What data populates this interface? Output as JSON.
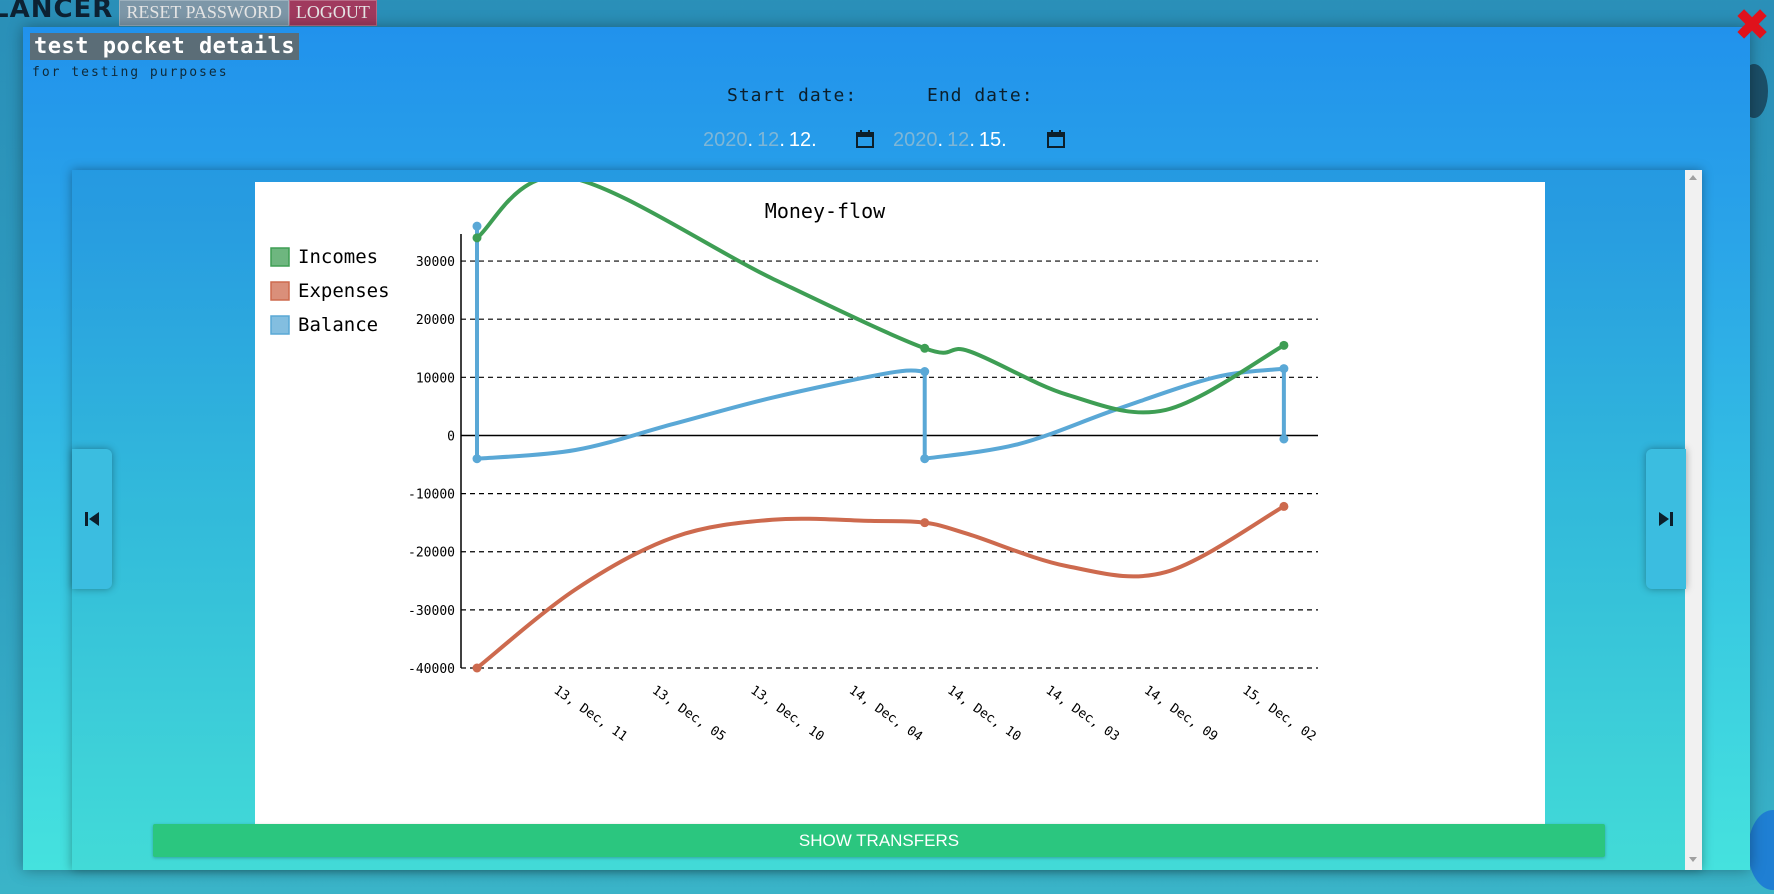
{
  "topbar": {
    "brand": "LANCER",
    "reset_label": "RESET PASSWORD",
    "logout_label": "LOGOUT"
  },
  "modal": {
    "title": "test pocket details",
    "subtitle": "for testing purposes",
    "close_icon": "close-x-icon",
    "start_label": "Start date:",
    "end_label": "End date:",
    "start_date": {
      "year": "2020",
      "month": "12",
      "day": "12"
    },
    "end_date": {
      "year": "2020",
      "month": "12",
      "day": "15"
    },
    "show_transfers_label": "SHOW TRANSFERS"
  },
  "colors": {
    "incomes": "#3e9e54",
    "expenses": "#cd6a4e",
    "balance": "#5aa8d6"
  },
  "chart_data": {
    "type": "line",
    "title": "Money-flow",
    "x": [
      "13, Dec, 11",
      "13, Dec, 05",
      "13, Dec, 10",
      "14, Dec, 04",
      "14, Dec, 10",
      "14, Dec, 03",
      "14, Dec, 09",
      "15, Dec, 02"
    ],
    "ylim": [
      -40000,
      35000
    ],
    "yticks": [
      30000,
      20000,
      10000,
      0,
      -10000,
      -20000,
      -30000,
      -40000
    ],
    "grid": true,
    "legend_position": "top-left",
    "series": [
      {
        "name": "Incomes",
        "points": [
          [
            0,
            34000
          ],
          [
            0.9,
            44500
          ],
          [
            3,
            27000
          ],
          [
            4.55,
            15000
          ],
          [
            5,
            14500
          ],
          [
            6,
            7000
          ],
          [
            7,
            4400
          ],
          [
            8.2,
            15500
          ]
        ],
        "markers": [
          [
            0,
            34000
          ],
          [
            4.55,
            15000
          ],
          [
            8.2,
            15500
          ]
        ]
      },
      {
        "name": "Expenses",
        "points": [
          [
            0,
            -40000
          ],
          [
            1,
            -26500
          ],
          [
            2,
            -17500
          ],
          [
            3,
            -14500
          ],
          [
            4,
            -14700
          ],
          [
            4.55,
            -15000
          ],
          [
            5,
            -17000
          ],
          [
            6,
            -22500
          ],
          [
            7,
            -23500
          ],
          [
            8.2,
            -12200
          ]
        ],
        "markers": [
          [
            0,
            -40000
          ],
          [
            4.55,
            -15000
          ],
          [
            8.2,
            -12200
          ]
        ]
      },
      {
        "name": "Balance",
        "points": [
          [
            0,
            36000
          ],
          [
            0,
            -4000
          ],
          [
            1,
            -2500
          ],
          [
            2,
            2000
          ],
          [
            3,
            6500
          ],
          [
            4.2,
            10800
          ],
          [
            4.55,
            11000
          ],
          [
            4.55,
            -4000
          ],
          [
            5.5,
            -1500
          ],
          [
            6.5,
            4500
          ],
          [
            7.5,
            10000
          ],
          [
            8.2,
            11500
          ],
          [
            8.2,
            -600
          ]
        ],
        "markers": [
          [
            0,
            36000
          ],
          [
            0,
            -4000
          ],
          [
            4.55,
            11000
          ],
          [
            4.55,
            -4000
          ],
          [
            8.2,
            11500
          ],
          [
            8.2,
            -600
          ]
        ]
      }
    ]
  }
}
